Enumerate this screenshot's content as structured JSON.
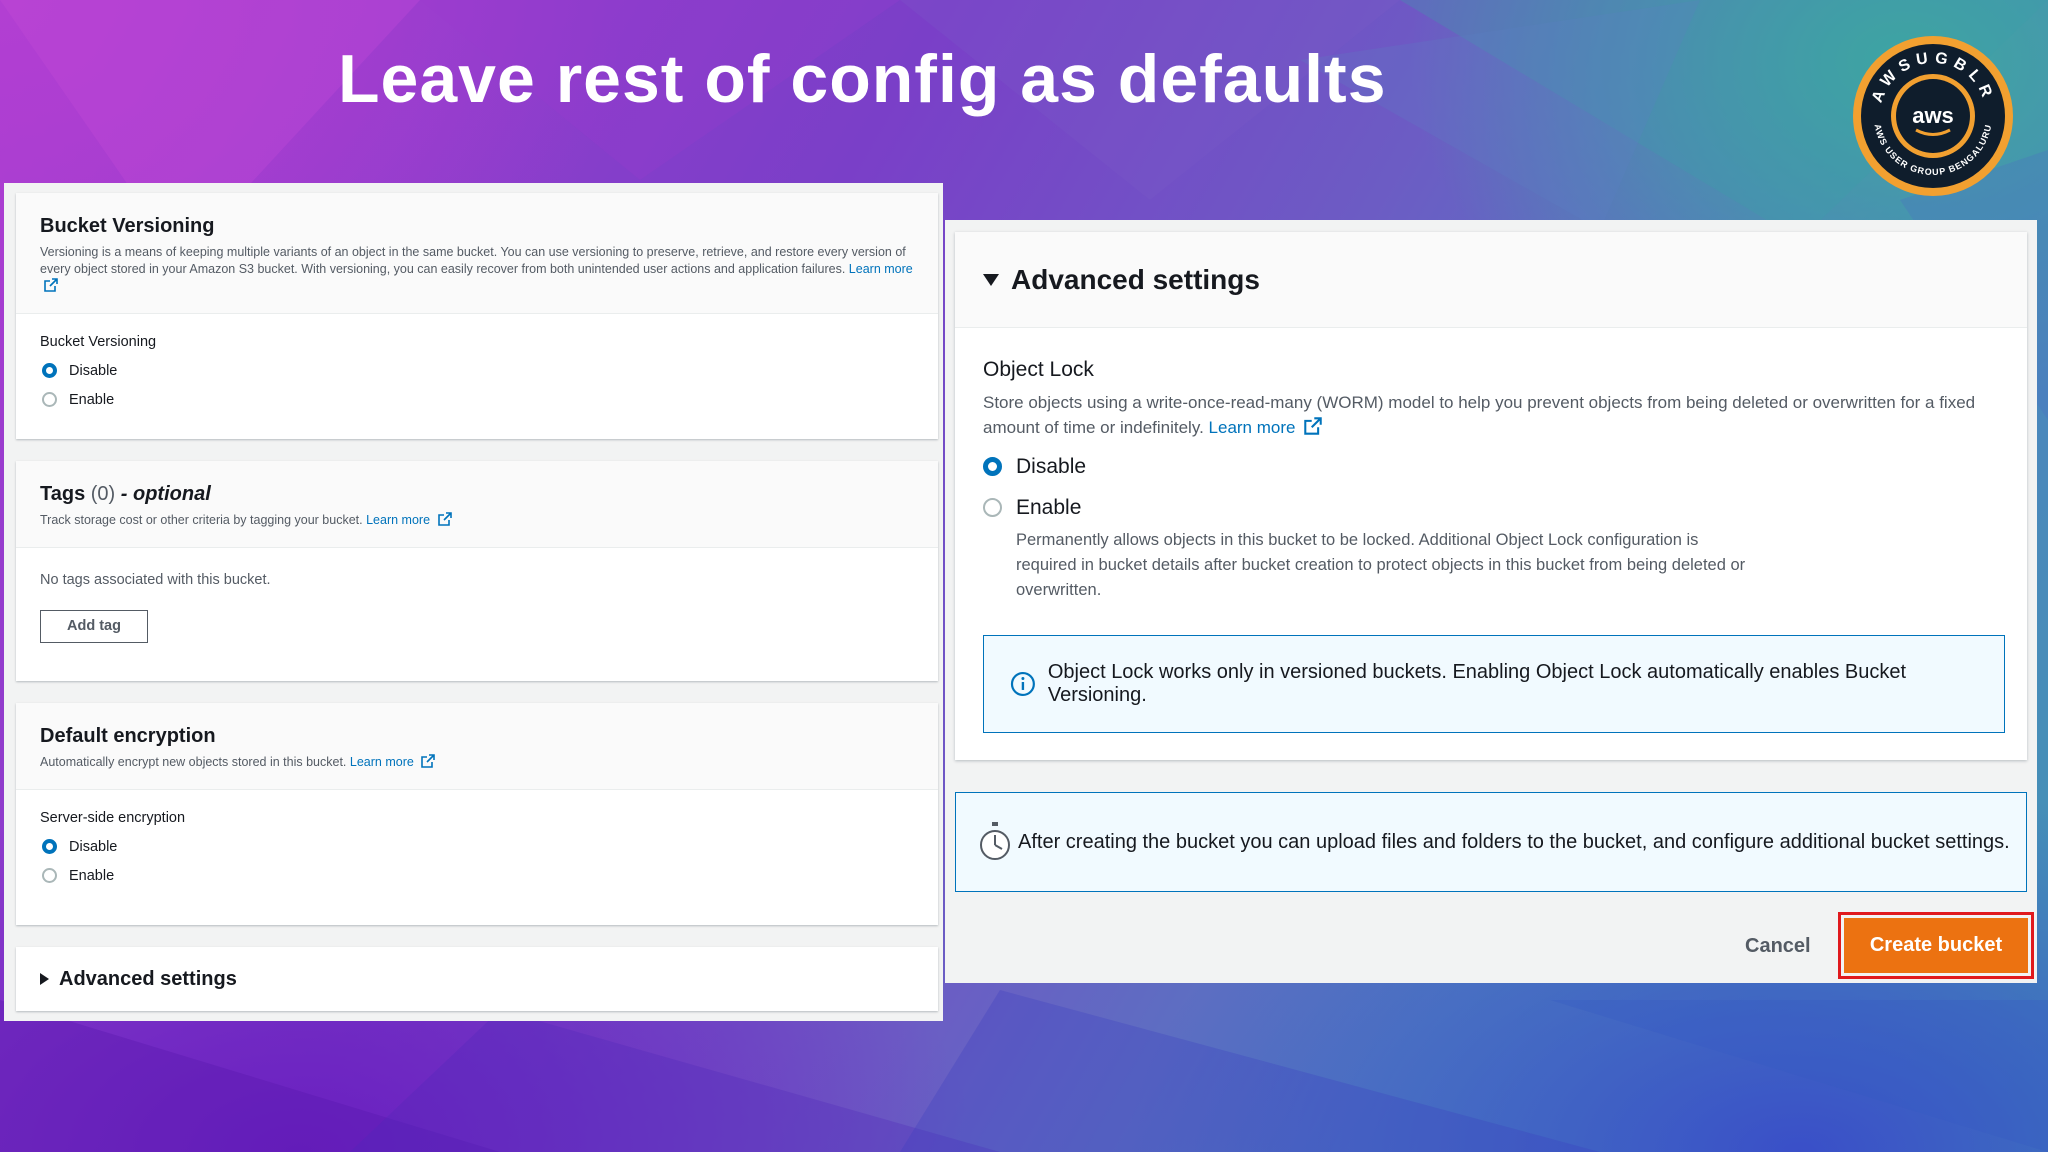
{
  "slide": {
    "title": "Leave rest of config as defaults"
  },
  "badge": {
    "top_text": "AWSUGBLR",
    "bottom_text": "AWS USER GROUP BENGALURU",
    "logo_text": "aws",
    "colors": {
      "ring": "#f2a030",
      "inner": "#0f1d2c"
    }
  },
  "left": {
    "versioning": {
      "title": "Bucket Versioning",
      "description": "Versioning is a means of keeping multiple variants of an object in the same bucket. You can use versioning to preserve, retrieve, and restore every version of every object stored in your Amazon S3 bucket. With versioning, you can easily recover from both unintended user actions and application failures.",
      "learn_more": "Learn more",
      "field_label": "Bucket Versioning",
      "options": [
        "Disable",
        "Enable"
      ],
      "selected": "Disable"
    },
    "tags": {
      "title": "Tags",
      "count": "(0)",
      "optional": "- optional",
      "description": "Track storage cost or other criteria by tagging your bucket.",
      "learn_more": "Learn more",
      "empty_text": "No tags associated with this bucket.",
      "add_button": "Add tag"
    },
    "encryption": {
      "title": "Default encryption",
      "description": "Automatically encrypt new objects stored in this bucket.",
      "learn_more": "Learn more",
      "field_label": "Server-side encryption",
      "options": [
        "Disable",
        "Enable"
      ],
      "selected": "Disable"
    },
    "advanced": {
      "title": "Advanced settings"
    }
  },
  "right": {
    "advanced": {
      "title": "Advanced settings"
    },
    "object_lock": {
      "label": "Object Lock",
      "description": "Store objects using a write-once-read-many (WORM) model to help you prevent objects from being deleted or overwritten for a fixed amount of time or indefinitely.",
      "learn_more": "Learn more",
      "options": [
        "Disable",
        "Enable"
      ],
      "selected": "Disable",
      "enable_hint": "Permanently allows objects in this bucket to be locked. Additional Object Lock configuration is required in bucket details after bucket creation to protect objects in this bucket from being deleted or overwritten.",
      "info": "Object Lock works only in versioned buckets. Enabling Object Lock automatically enables Bucket Versioning."
    },
    "note": "After creating the bucket you can upload files and folders to the bucket, and configure additional bucket settings.",
    "cancel": "Cancel",
    "create": "Create bucket",
    "colors": {
      "primary": "#ec7211",
      "highlight": "#e0191d",
      "link": "#0073bb"
    }
  }
}
